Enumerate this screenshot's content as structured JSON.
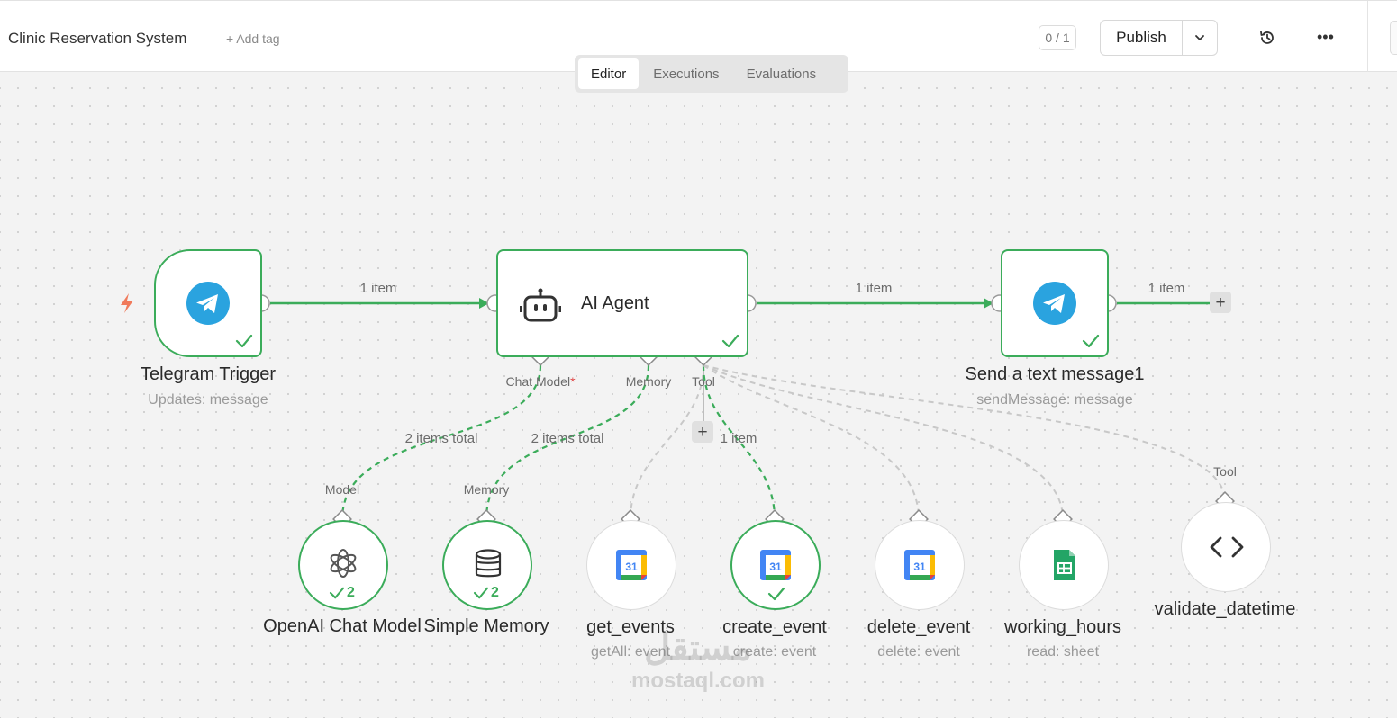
{
  "header": {
    "workflow_title": "Clinic Reservation System",
    "add_tag": "+ Add tag",
    "counter": "0 / 1",
    "publish": "Publish"
  },
  "tabs": [
    {
      "label": "Editor",
      "active": true
    },
    {
      "label": "Executions",
      "active": false
    },
    {
      "label": "Evaluations",
      "active": false
    }
  ],
  "nodes": {
    "telegram_trigger": {
      "title": "Telegram Trigger",
      "subtitle": "Updates: message"
    },
    "ai_agent": {
      "title": "AI Agent"
    },
    "send_message": {
      "title": "Send a text message1",
      "subtitle": "sendMessage: message"
    },
    "openai": {
      "title": "OpenAI Chat Model",
      "count": "2"
    },
    "memory": {
      "title": "Simple Memory",
      "count": "2"
    },
    "get_events": {
      "title": "get_events",
      "subtitle": "getAll: event"
    },
    "create_event": {
      "title": "create_event",
      "subtitle": "create: event"
    },
    "delete_event": {
      "title": "delete_event",
      "subtitle": "delete: event"
    },
    "working_hours": {
      "title": "working_hours",
      "subtitle": "read: sheet"
    },
    "validate_datetime": {
      "title": "validate_datetime"
    }
  },
  "edge_labels": {
    "trigger_to_agent": "1 item",
    "agent_to_send": "1 item",
    "send_out": "1 item",
    "chat_model_items": "2 items total",
    "memory_items": "2 items total",
    "tool_items": "1 item"
  },
  "port_labels": {
    "chat_model": "Chat Model",
    "chat_model_required": "*",
    "memory": "Memory",
    "tool": "Tool",
    "model_in": "Model",
    "memory_in": "Memory",
    "tool_in": "Tool"
  },
  "watermark": {
    "arabic": "مستقل",
    "latin": "mostaql.com"
  },
  "colors": {
    "success": "#3bac5a",
    "telegram": "#2aa3df",
    "trigger_bolt": "#f07a5b",
    "required": "#e04545",
    "dashed_inactive": "#c8c8c8"
  }
}
